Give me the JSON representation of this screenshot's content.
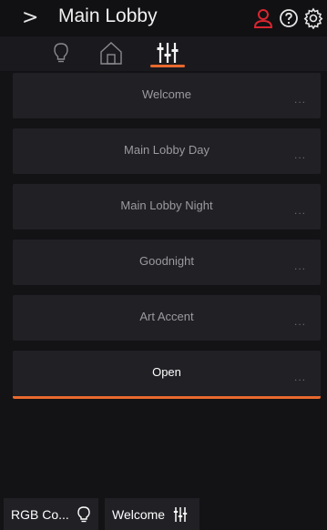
{
  "header": {
    "title": "Main Lobby",
    "chevron": ">",
    "icons": [
      "user-icon",
      "help-icon",
      "gear-icon"
    ],
    "accent_alert": "#d8262f"
  },
  "tabs": [
    {
      "name": "lights",
      "icon": "bulb-icon",
      "active": false
    },
    {
      "name": "rooms",
      "icon": "home-icon",
      "active": false
    },
    {
      "name": "scenes",
      "icon": "sliders-icon",
      "active": true
    }
  ],
  "scenes": [
    {
      "label": "Welcome",
      "more": "..."
    },
    {
      "label": "Main Lobby Day",
      "more": "..."
    },
    {
      "label": "Main Lobby Night",
      "more": "..."
    },
    {
      "label": "Goodnight",
      "more": "..."
    },
    {
      "label": "Art Accent",
      "more": "..."
    },
    {
      "label": "Open",
      "more": "...",
      "active": true
    }
  ],
  "footer": {
    "rgb_label": "RGB Co...",
    "scene_label": "Welcome"
  },
  "colors": {
    "accent": "#e8692e",
    "background": "#131316",
    "card": "#202025"
  }
}
